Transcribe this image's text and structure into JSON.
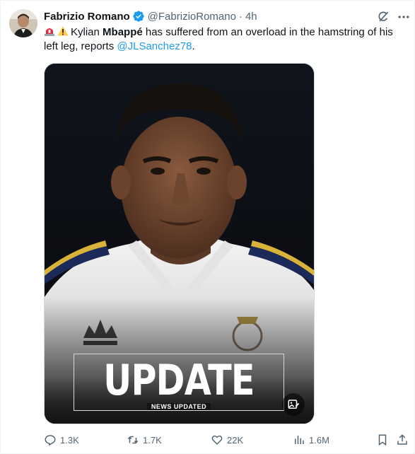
{
  "tweet": {
    "author_name": "Fabrizio Romano",
    "handle": "@FabrizioRomano",
    "separator": "·",
    "time": "4h",
    "text_pre": "Kylian ",
    "text_bold": "Mbappé",
    "text_mid": " has suffered from an overload in the hamstring of his left leg, reports ",
    "mention": "@JLSanchez78",
    "text_post": "."
  },
  "media": {
    "headline": "UPDATE",
    "subheadline": "NEWS UPDATED"
  },
  "actions": {
    "replies": "1.3K",
    "reposts": "1.7K",
    "likes": "22K",
    "views": "1.6M"
  },
  "colors": {
    "accent": "#1d9bf0",
    "text": "#0f1419",
    "muted": "#536471"
  }
}
